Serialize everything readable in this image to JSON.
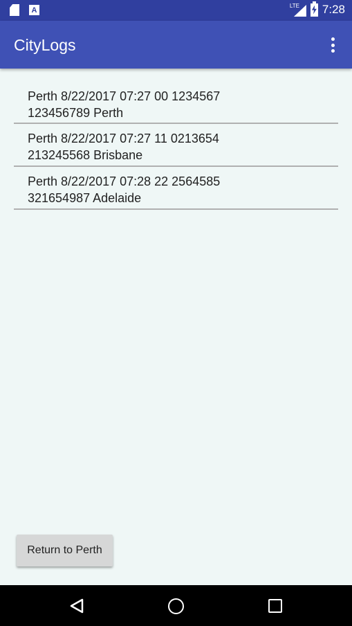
{
  "status_bar": {
    "time": "7:28",
    "network": "LTE",
    "icons": [
      "sd-card-icon",
      "a-notification-icon",
      "signal-icon",
      "battery-charging-icon"
    ]
  },
  "app_bar": {
    "title": "CityLogs",
    "overflow_icon": "more-vert-icon"
  },
  "logs": [
    {
      "line1": "Perth  8/22/2017 07:27  00  1234567",
      "line2": "123456789  Perth"
    },
    {
      "line1": "Perth  8/22/2017 07:27  11 0213654",
      "line2": "213245568  Brisbane"
    },
    {
      "line1": "Perth  8/22/2017 07:28  22 2564585",
      "line2": "321654987  Adelaide"
    }
  ],
  "return_button": {
    "label": "Return to Perth"
  },
  "colors": {
    "status_bar": "#303f9f",
    "app_bar": "#3f51b5",
    "background": "#eff7f6",
    "button": "#d6d7d7"
  }
}
